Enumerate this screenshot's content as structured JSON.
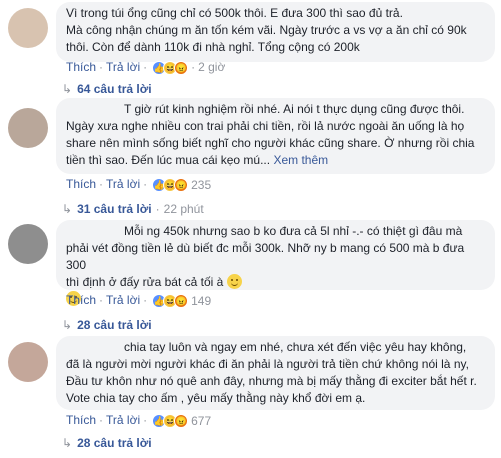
{
  "labels": {
    "like": "Thích",
    "reply": "Trả lời"
  },
  "comments": [
    {
      "text": "Vì trong túi ổng cũng chỉ có 500k thôi. E đưa 300 thì sao đủ trả. Mà công nhận chúng m ăn tốn kém vãi. Ngày trước a vs vợ a ăn chỉ có 90k thôi. Còn để dành 110k đi nhà nghỉ. Tổng cộng có 200k",
      "lines": [
        "Vì trong túi ổng cũng chỉ có 500k thôi. E đưa 300 thì sao đủ trả.",
        "Mà công nhận chúng m ăn tốn kém vãi. Ngày trước a vs vợ a ăn chỉ có 90k",
        "thôi. Còn để dành 110k đi nhà nghỉ. Tổng cộng có 200k"
      ],
      "reaction_count": "",
      "time": "2 giờ",
      "replies": "64 câu trả lời"
    },
    {
      "lines": [
        "T giờ rút kinh nghiệm rồi nhé. Ai nói t thực dụng cũng được thôi.",
        "Ngày xưa nghe nhiều con trai phải chi tiền, rồi lả nước ngoài ăn uống là họ",
        "share nên mình sống biết nghĩ cho người khác cũng share. Ờ nhưng rồi chia",
        "tiền thì sao. Đến lúc mua cái kẹo mú..."
      ],
      "see_more": "Xem thêm",
      "reaction_count": "235",
      "time": "",
      "replies": "31 câu trả lời",
      "replies_time": "22 phút"
    },
    {
      "lines": [
        "Mỗi ng 450k nhưng sao b ko đưa cả 5l nhỉ -.- có thiệt gì đâu mà",
        "phải vét đồng tiền lẻ dù biết đc mỗi 300k. Nhỡ ny b mang có 500 mà b đưa 300",
        "thì định ở đấy rửa bát cả tối à"
      ],
      "reaction_count": "149",
      "time": "",
      "replies": "28 câu trả lời"
    },
    {
      "lines": [
        "chia tay luôn và ngay em nhé, chưa xét đến việc yêu hay không,",
        "đã là người mời người khác đi ăn phải là người trả tiền chứ không nói là ny,",
        "Đầu tư khôn như nó quê anh đây, nhưng mà bị mấy thằng đi exciter bắt hết r.",
        "Vote chia tay cho ấm , yêu mấy thằng này khổ đời em ạ."
      ],
      "reaction_count": "677",
      "time": "",
      "replies": "28 câu trả lời"
    }
  ]
}
